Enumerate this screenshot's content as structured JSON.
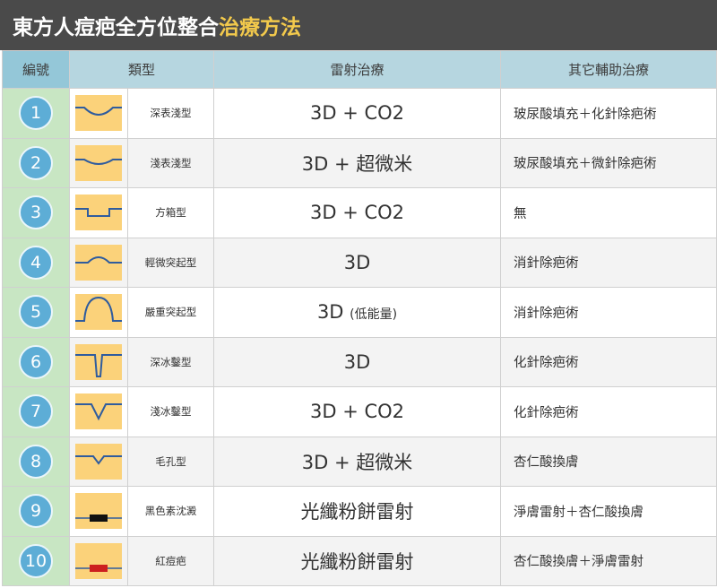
{
  "title": {
    "main": "東方人痘疤全方位整合",
    "accent": "治療方法"
  },
  "headers": {
    "number": "編號",
    "type": "類型",
    "laser": "雷射治療",
    "aux": "其它輔助治療"
  },
  "rows": [
    {
      "number": "1",
      "type": "深表淺型",
      "icon": "shallow-deep-wave-icon",
      "laser": "3D + CO2",
      "laser_small": "",
      "aux": "玻尿酸填充＋化針除疤術"
    },
    {
      "number": "2",
      "type": "淺表淺型",
      "icon": "shallow-shallow-wave-icon",
      "laser": "3D + 超微米",
      "laser_small": "",
      "aux": "玻尿酸填充＋微針除疤術"
    },
    {
      "number": "3",
      "type": "方箱型",
      "icon": "box-scar-icon",
      "laser": "3D + CO2",
      "laser_small": "",
      "aux": "無"
    },
    {
      "number": "4",
      "type": "輕微突起型",
      "icon": "slight-raised-icon",
      "laser": "3D",
      "laser_small": "",
      "aux": "消針除疤術"
    },
    {
      "number": "5",
      "type": "嚴重突起型",
      "icon": "severe-raised-icon",
      "laser": "3D",
      "laser_small": "(低能量)",
      "aux": "消針除疤術"
    },
    {
      "number": "6",
      "type": "深冰鑿型",
      "icon": "deep-icepick-icon",
      "laser": "3D",
      "laser_small": "",
      "aux": "化針除疤術"
    },
    {
      "number": "7",
      "type": "淺冰鑿型",
      "icon": "shallow-icepick-icon",
      "laser": "3D + CO2",
      "laser_small": "",
      "aux": "化針除疤術"
    },
    {
      "number": "8",
      "type": "毛孔型",
      "icon": "pore-scar-icon",
      "laser": "3D + 超微米",
      "laser_small": "",
      "aux": "杏仁酸換膚"
    },
    {
      "number": "9",
      "type": "黑色素沈澱",
      "icon": "black-pigment-icon",
      "laser": "光纖粉餅雷射",
      "laser_small": "",
      "aux": "淨膚雷射＋杏仁酸換膚"
    },
    {
      "number": "10",
      "type": "紅痘疤",
      "icon": "red-pigment-icon",
      "laser": "光纖粉餅雷射",
      "laser_small": "",
      "aux": "杏仁酸換膚＋淨膚雷射"
    }
  ],
  "colors": {
    "header_bar": "#4a4a4a",
    "accent": "#f2c94c",
    "circle": "#5dadd6",
    "number_bg": "#c8e6c3",
    "skin": "#fbd27a",
    "line": "#2f5c9e"
  }
}
